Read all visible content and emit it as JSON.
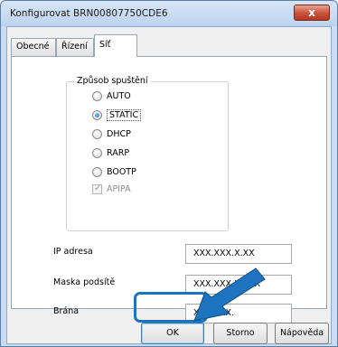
{
  "window": {
    "title": "Konfigurovat BRN00807750CDE6",
    "close_label": "x"
  },
  "tabs": [
    {
      "label": "Obecné"
    },
    {
      "label": "Řízení"
    },
    {
      "label": "Síť"
    }
  ],
  "group": {
    "title": "Způsob spuštění",
    "options": [
      {
        "label": "AUTO",
        "checked": false
      },
      {
        "label": "STATIC",
        "checked": true
      },
      {
        "label": "DHCP",
        "checked": false
      },
      {
        "label": "RARP",
        "checked": false
      },
      {
        "label": "BOOTP",
        "checked": false
      }
    ],
    "apipa": {
      "label": "APIPA",
      "checked": true,
      "enabled": false
    }
  },
  "fields": {
    "ip": {
      "label": "IP adresa",
      "value": "XXX.XXX.X.XX"
    },
    "mask": {
      "label": "Maska podsítě",
      "value": "XXX.XXX.XXX.X"
    },
    "gateway": {
      "label": "Brána",
      "value": "XXX.XXX."
    }
  },
  "buttons": {
    "ok": "OK",
    "cancel": "Storno",
    "help": "Nápověda"
  },
  "colors": {
    "highlight": "#1e73be",
    "arrow": "#1e73be"
  }
}
